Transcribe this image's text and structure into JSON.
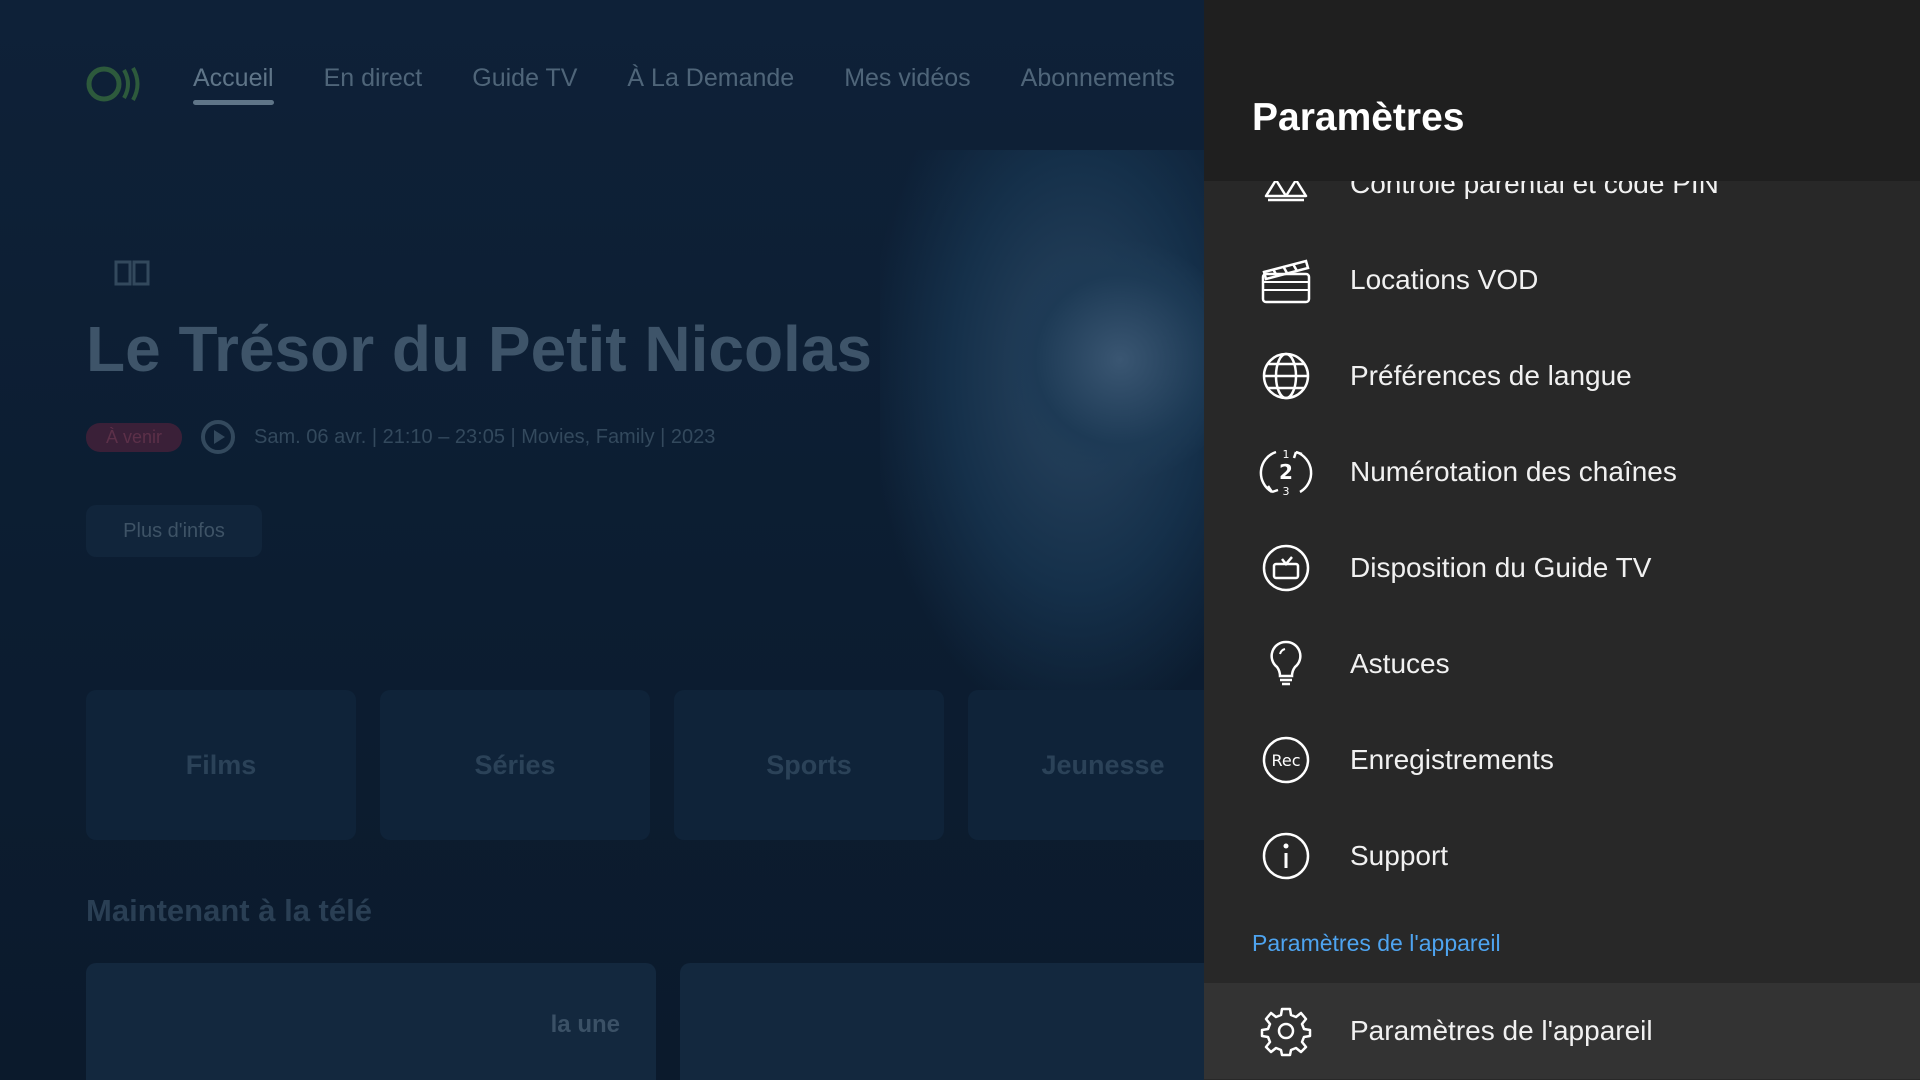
{
  "background": {
    "nav": [
      "Accueil",
      "En direct",
      "Guide TV",
      "À La Demande",
      "Mes vidéos",
      "Abonnements"
    ],
    "hero_title": "Le Trésor du Petit Nicolas",
    "badge": "À venir",
    "meta": "Sam. 06 avr. | 21:10 – 23:05 | Movies, Family | 2023",
    "more_info_label": "Plus d'infos",
    "categories": [
      "Films",
      "Séries",
      "Sports",
      "Jeunesse"
    ],
    "now_title": "Maintenant à la télé",
    "thumb_label": "la une"
  },
  "settings": {
    "title": "Paramètres",
    "items": [
      {
        "label": "Contrôle parental et code PIN",
        "icon": "parental-control-icon"
      },
      {
        "label": "Locations VOD",
        "icon": "clapperboard-icon"
      },
      {
        "label": "Préférences de langue",
        "icon": "globe-icon"
      },
      {
        "label": "Numérotation des chaînes",
        "icon": "channel-numbering-icon"
      },
      {
        "label": "Disposition du Guide TV",
        "icon": "tv-guide-icon"
      },
      {
        "label": "Astuces",
        "icon": "lightbulb-icon"
      },
      {
        "label": "Enregistrements",
        "icon": "rec-icon"
      },
      {
        "label": "Support",
        "icon": "info-icon"
      }
    ],
    "section_label": "Paramètres de l'appareil",
    "device_item": {
      "label": "Paramètres de l'appareil",
      "icon": "gear-icon"
    }
  }
}
